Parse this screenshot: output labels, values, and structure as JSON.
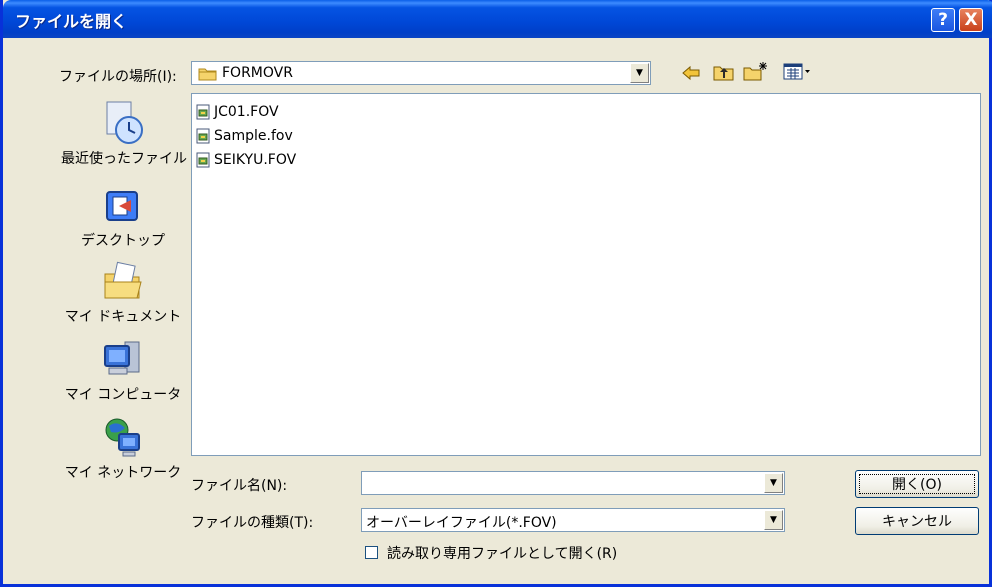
{
  "window": {
    "title": "ファイルを開く",
    "help_label": "?",
    "close_label": "X"
  },
  "look_in": {
    "label": "ファイルの場所(I):",
    "value": "FORMOVR"
  },
  "places": [
    {
      "label": "最近使ったファイル",
      "icon": "recent-documents-icon"
    },
    {
      "label": "デスクトップ",
      "icon": "desktop-icon"
    },
    {
      "label": "マイ ドキュメント",
      "icon": "my-documents-icon"
    },
    {
      "label": "マイ コンピュータ",
      "icon": "my-computer-icon"
    },
    {
      "label": "マイ ネットワーク",
      "icon": "my-network-icon"
    }
  ],
  "files": [
    {
      "name": "JC01.FOV"
    },
    {
      "name": "Sample.fov"
    },
    {
      "name": "SEIKYU.FOV"
    }
  ],
  "filename": {
    "label": "ファイル名(N):",
    "value": ""
  },
  "filetype": {
    "label": "ファイルの種類(T):",
    "value": "オーバーレイファイル(*.FOV)"
  },
  "readonly": {
    "label": "読み取り専用ファイルとして開く(R)",
    "checked": false
  },
  "buttons": {
    "open": "開く(O)",
    "cancel": "キャンセル"
  },
  "colors": {
    "title_bar": "#0054e3",
    "dialog_bg": "#ece9d8",
    "close_button": "#c8401a"
  }
}
